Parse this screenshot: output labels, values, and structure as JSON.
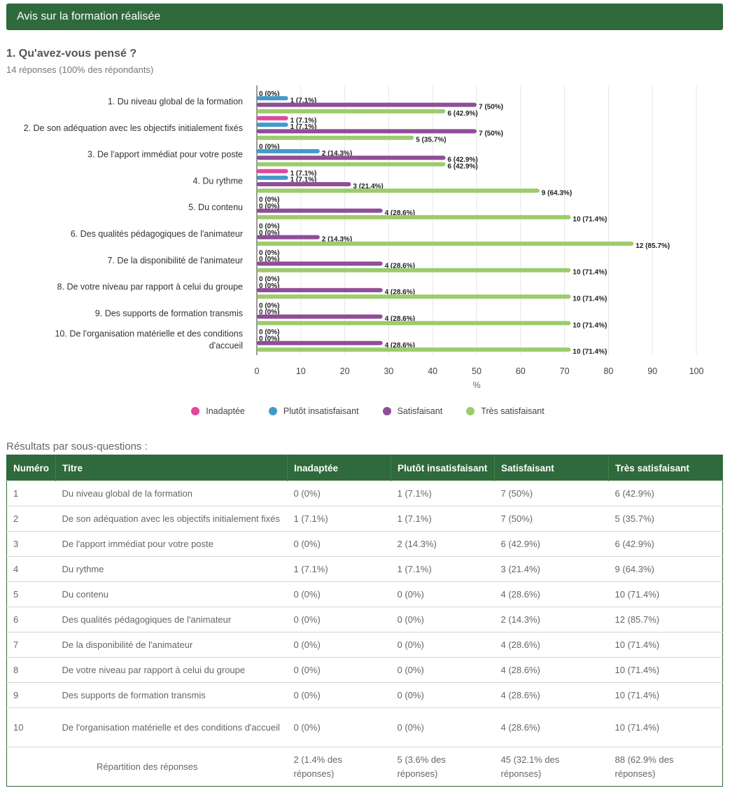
{
  "header": {
    "title": "Avis sur la formation réalisée"
  },
  "question": {
    "title": "1. Qu'avez-vous pensé ?",
    "subtitle": "14 réponses (100% des répondants)"
  },
  "chart_data": {
    "type": "bar",
    "orientation": "horizontal",
    "categories": [
      [
        "1. Du niveau global de la formation"
      ],
      [
        "2. De son adéquation avec les objectifs initialement fixés"
      ],
      [
        "3. De l'apport immédiat pour votre poste"
      ],
      [
        "4. Du rythme"
      ],
      [
        "5. Du contenu"
      ],
      [
        "6. Des qualités pédagogiques de l'animateur"
      ],
      [
        "7. De la disponibilité de l'animateur"
      ],
      [
        "8. De votre niveau par rapport à celui du groupe"
      ],
      [
        "9. Des supports de formation transmis"
      ],
      [
        "10. De l'organisation matérielle et des conditions",
        "d'accueil"
      ]
    ],
    "series": [
      {
        "name": "Inadaptée",
        "color": "#e0479e",
        "values": [
          0,
          7.1,
          0,
          7.1,
          0,
          0,
          0,
          0,
          0,
          0
        ],
        "labels": [
          "0 (0%)",
          "1 (7.1%)",
          "0 (0%)",
          "1 (7.1%)",
          "0 (0%)",
          "0 (0%)",
          "0 (0%)",
          "0 (0%)",
          "0 (0%)",
          "0 (0%)"
        ]
      },
      {
        "name": "Plutôt insatisfaisant",
        "color": "#4499c9",
        "values": [
          7.1,
          7.1,
          14.3,
          7.1,
          0,
          0,
          0,
          0,
          0,
          0
        ],
        "labels": [
          "1 (7.1%)",
          "1 (7.1%)",
          "2 (14.3%)",
          "1 (7.1%)",
          "0 (0%)",
          "0 (0%)",
          "0 (0%)",
          "0 (0%)",
          "0 (0%)",
          "0 (0%)"
        ]
      },
      {
        "name": "Satisfaisant",
        "color": "#8f4e97",
        "values": [
          50,
          50,
          42.9,
          21.4,
          28.6,
          14.3,
          28.6,
          28.6,
          28.6,
          28.6
        ],
        "labels": [
          "7 (50%)",
          "7 (50%)",
          "6 (42.9%)",
          "3 (21.4%)",
          "4 (28.6%)",
          "2 (14.3%)",
          "4 (28.6%)",
          "4 (28.6%)",
          "4 (28.6%)",
          "4 (28.6%)"
        ]
      },
      {
        "name": "Très satisfaisant",
        "color": "#9ccc6b",
        "values": [
          42.9,
          35.7,
          42.9,
          64.3,
          71.4,
          85.7,
          71.4,
          71.4,
          71.4,
          71.4
        ],
        "labels": [
          "6 (42.9%)",
          "5 (35.7%)",
          "6 (42.9%)",
          "9 (64.3%)",
          "10 (71.4%)",
          "12 (85.7%)",
          "10 (71.4%)",
          "10 (71.4%)",
          "10 (71.4%)",
          "10 (71.4%)"
        ]
      }
    ],
    "xlabel": "%",
    "xlim": [
      0,
      100
    ],
    "xticks": [
      0,
      10,
      20,
      30,
      40,
      50,
      60,
      70,
      80,
      90,
      100
    ],
    "grid": true,
    "legend_position": "bottom"
  },
  "table": {
    "caption": "Résultats par sous-questions :",
    "headers": [
      "Numéro",
      "Titre",
      "Inadaptée",
      "Plutôt insatisfaisant",
      "Satisfaisant",
      "Très satisfaisant"
    ],
    "rows": [
      [
        "1",
        "Du niveau global de la formation",
        "0 (0%)",
        "1 (7.1%)",
        "7 (50%)",
        "6 (42.9%)"
      ],
      [
        "2",
        "De son adéquation avec les objectifs initialement fixés",
        "1 (7.1%)",
        "1 (7.1%)",
        "7 (50%)",
        "5 (35.7%)"
      ],
      [
        "3",
        "De l'apport immédiat pour votre poste",
        "0 (0%)",
        "2 (14.3%)",
        "6 (42.9%)",
        "6 (42.9%)"
      ],
      [
        "4",
        "Du rythme",
        "1 (7.1%)",
        "1 (7.1%)",
        "3 (21.4%)",
        "9 (64.3%)"
      ],
      [
        "5",
        "Du contenu",
        "0 (0%)",
        "0 (0%)",
        "4 (28.6%)",
        "10 (71.4%)"
      ],
      [
        "6",
        "Des qualités pédagogiques de l'animateur",
        "0 (0%)",
        "0 (0%)",
        "2 (14.3%)",
        "12 (85.7%)"
      ],
      [
        "7",
        "De la disponibilité de l'animateur",
        "0 (0%)",
        "0 (0%)",
        "4 (28.6%)",
        "10 (71.4%)"
      ],
      [
        "8",
        "De votre niveau par rapport à celui du groupe",
        "0 (0%)",
        "0 (0%)",
        "4 (28.6%)",
        "10 (71.4%)"
      ],
      [
        "9",
        "Des supports de formation transmis",
        "0 (0%)",
        "0 (0%)",
        "4 (28.6%)",
        "10 (71.4%)"
      ],
      [
        "10",
        "De l'organisation matérielle et des conditions d'accueil",
        "0 (0%)",
        "0 (0%)",
        "4 (28.6%)",
        "10 (71.4%)"
      ]
    ],
    "summary": {
      "label": "Répartition des réponses",
      "values": [
        "2 (1.4% des réponses)",
        "5 (3.6% des réponses)",
        "45 (32.1% des réponses)",
        "88 (62.9% des réponses)"
      ]
    }
  }
}
